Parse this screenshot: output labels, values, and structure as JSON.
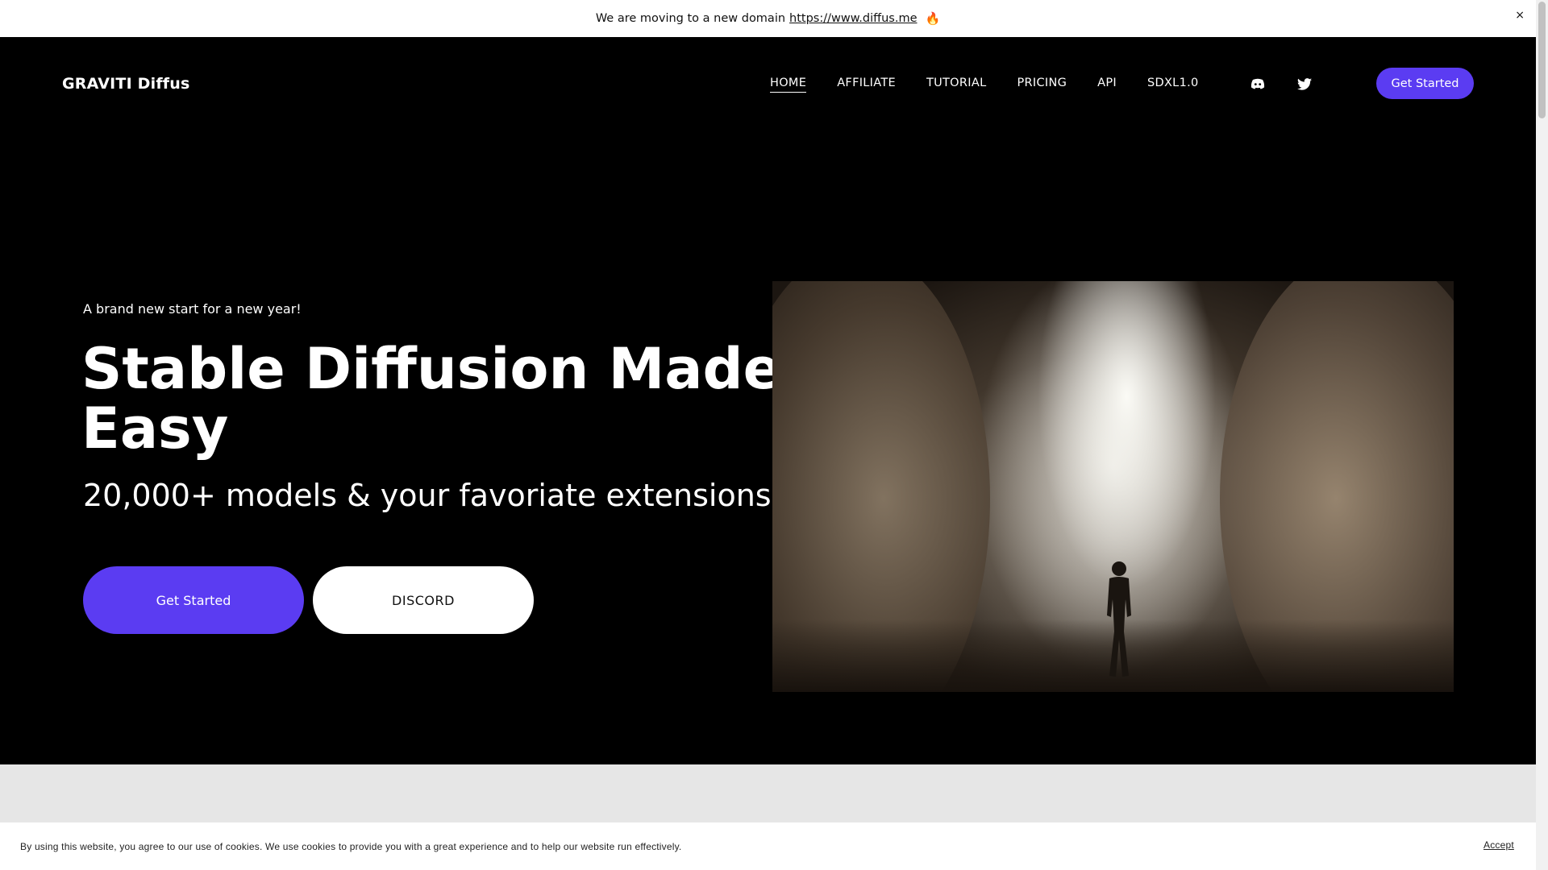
{
  "announcement": {
    "text": "We are moving to a new domain",
    "link": "https://www.diffus.me",
    "close": "×"
  },
  "nav": {
    "logo": "GRAVITI Diffus",
    "items": [
      {
        "label": "HOME",
        "active": true
      },
      {
        "label": "AFFILIATE",
        "active": false
      },
      {
        "label": "TUTORIAL",
        "active": false
      },
      {
        "label": "PRICING",
        "active": false
      },
      {
        "label": "API",
        "active": false
      },
      {
        "label": "SDXL1.0",
        "active": false
      }
    ],
    "social": [
      "discord-icon",
      "twitter-icon"
    ],
    "cta": "Get Started"
  },
  "hero": {
    "eyebrow": "A brand new start for a new year!",
    "headline": "Stable Diffusion Made Easy",
    "subline": "20,000+ models & your favoriate extensions",
    "primary_button": "Get Started",
    "secondary_button": "DISCORD"
  },
  "cookie": {
    "text": "By using this website, you agree to our use of cookies. We use cookies to provide you with a great experience and to help our website run effectively.",
    "accept": "Accept"
  },
  "colors": {
    "accent": "#5b3cf2",
    "background": "#000000",
    "band": "#e6e6e6"
  }
}
